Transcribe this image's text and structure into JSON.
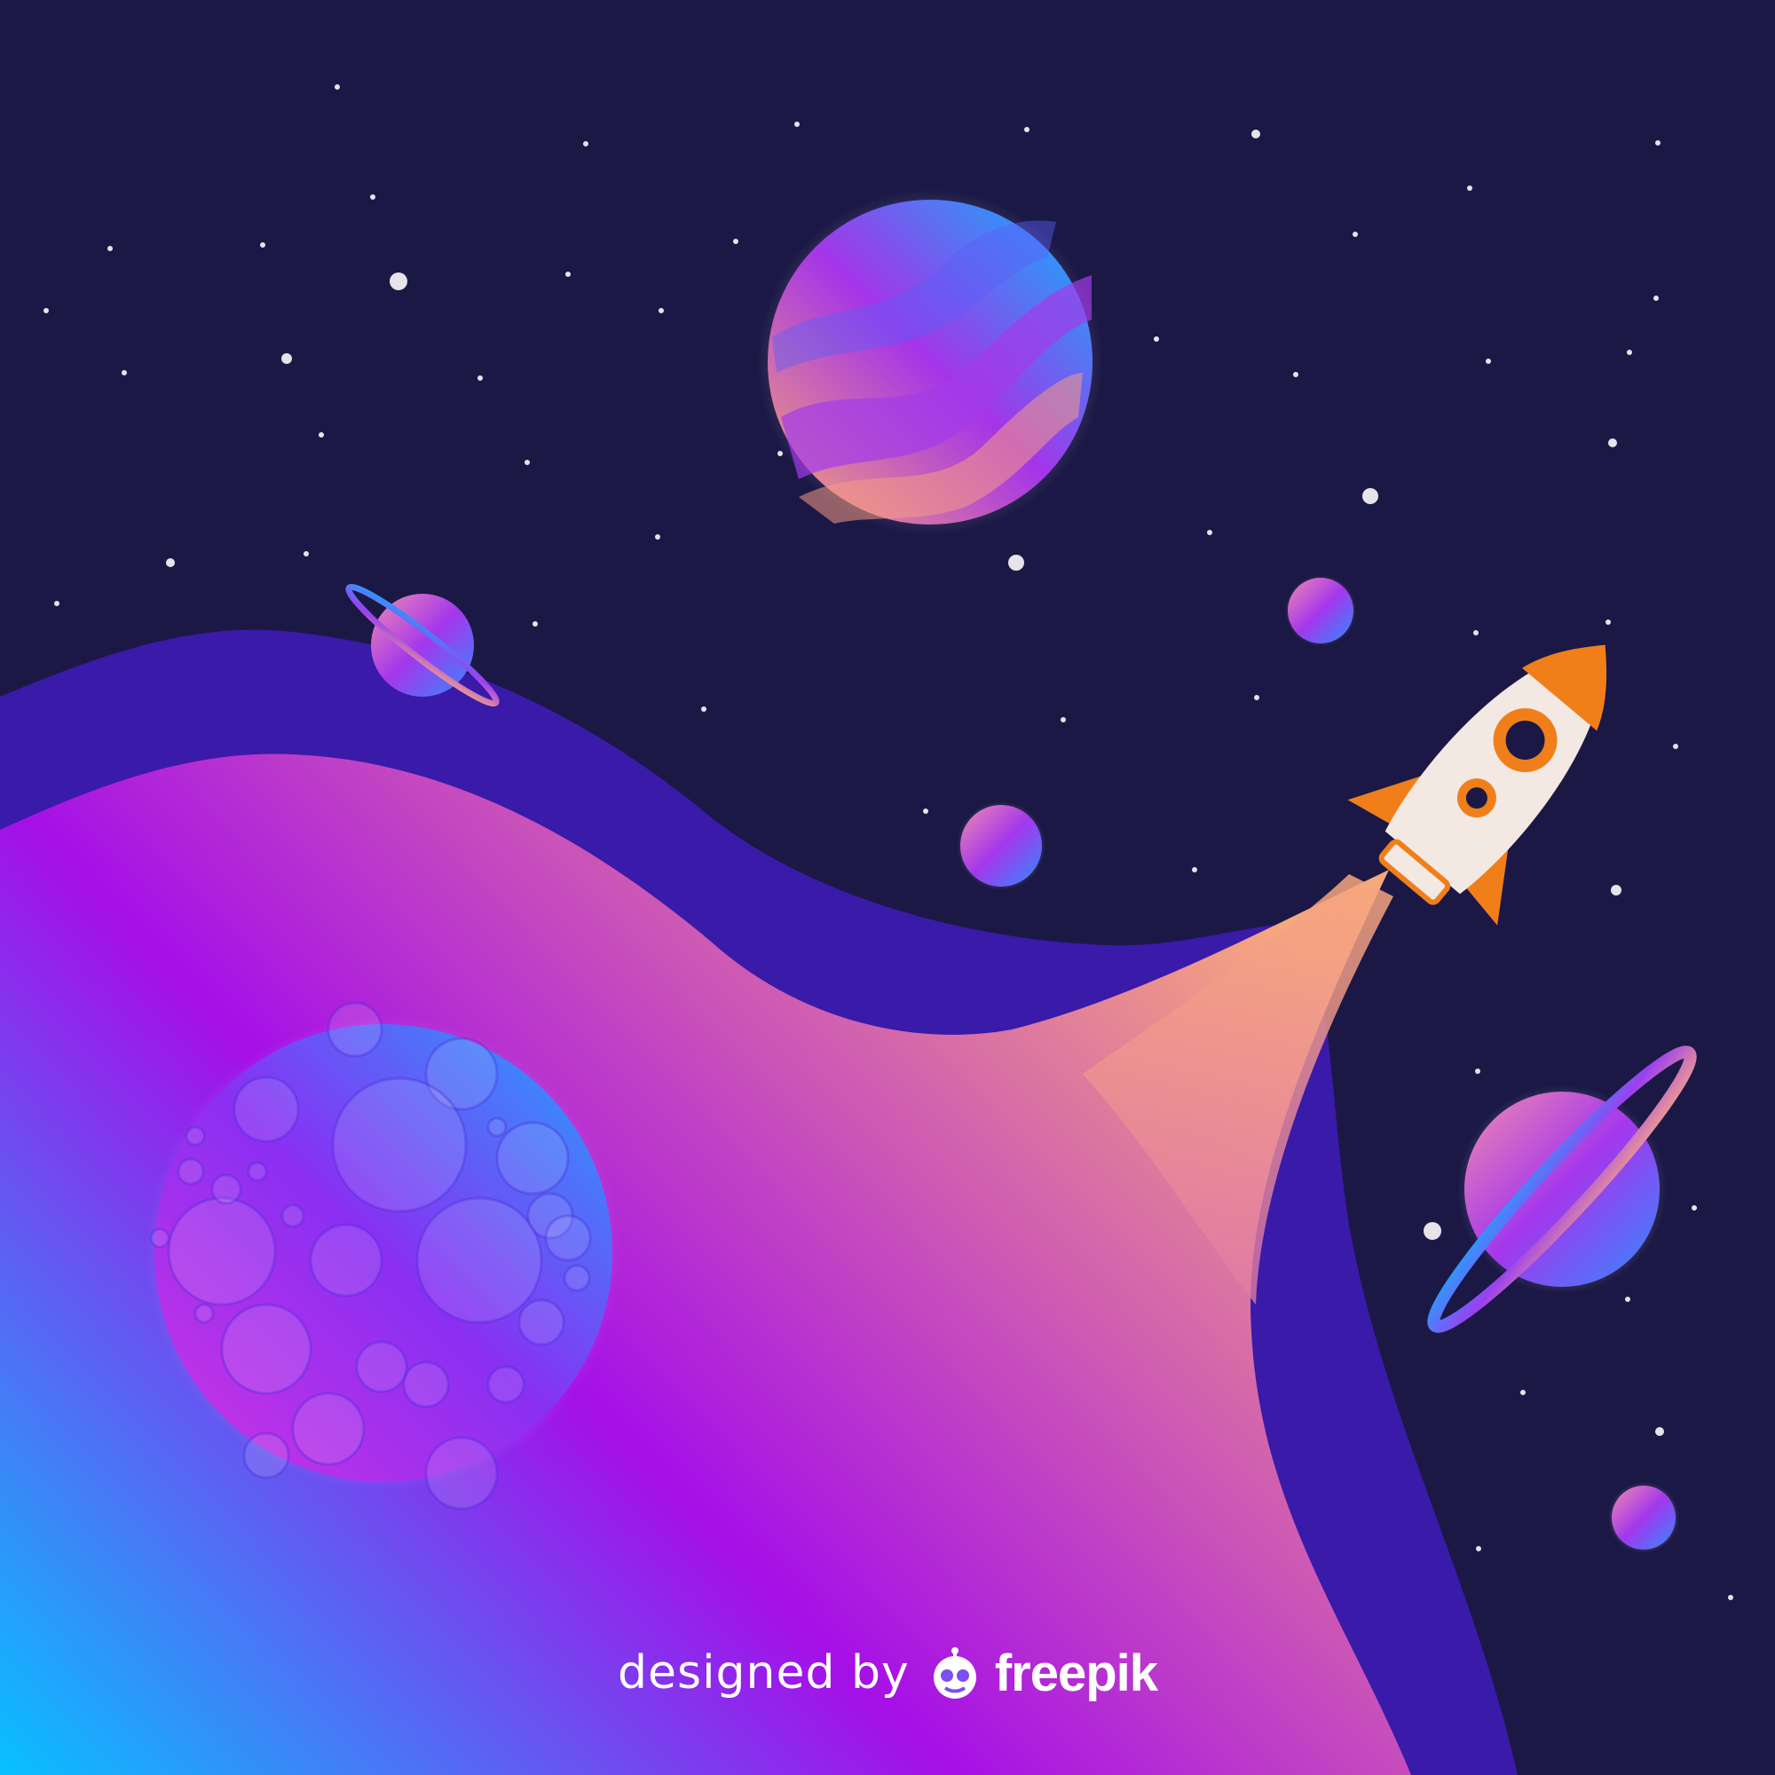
{
  "scene": {
    "background_color": "#1b1846",
    "accent_colors": {
      "wave_dark": "#3a1aa8",
      "wave_blue": "#07c1ff",
      "wave_violet": "#a50fe8",
      "wave_peach": "#f7a87d",
      "rocket_body": "#f4e8e2",
      "rocket_fin": "#f07f1a"
    },
    "icons": [
      "star-icon",
      "planet-icon",
      "ringed-planet-icon",
      "cratered-moon-icon",
      "rocket-icon",
      "freepik-logo-icon"
    ]
  },
  "credit": {
    "prefix": "designed by",
    "brand": "freepik"
  }
}
